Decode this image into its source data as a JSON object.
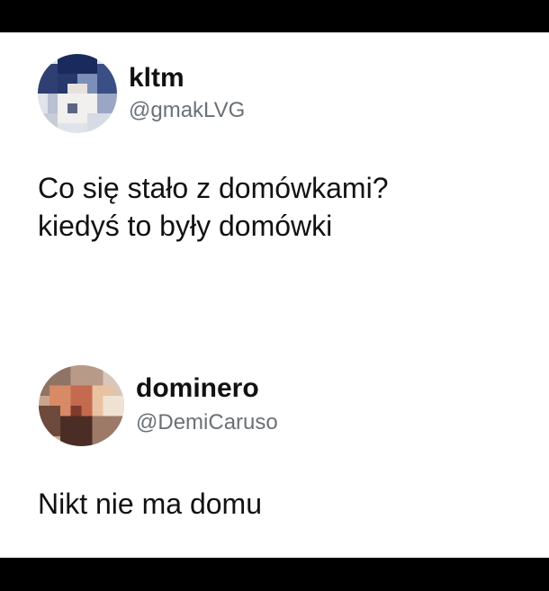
{
  "tweets": [
    {
      "display_name": "kltm",
      "handle": "@gmakLVG",
      "text_lines": [
        "Co się stało z domówkami?",
        "kiedyś to były domówki"
      ],
      "avatar_icon": "pixelated-avatar-icon"
    },
    {
      "display_name": "dominero",
      "handle": "@DemiCaruso",
      "text_lines": [
        "Nikt nie ma domu"
      ],
      "avatar_icon": "pixelated-avatar-icon"
    }
  ],
  "colors": {
    "frame_bar": "#000000",
    "background": "#ffffff",
    "name_text": "#111111",
    "handle_text": "#6a7177"
  }
}
